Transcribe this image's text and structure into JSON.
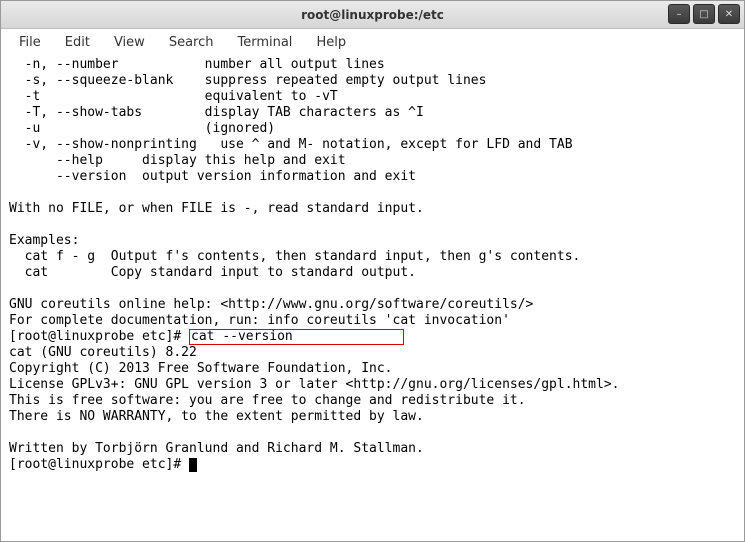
{
  "titlebar": {
    "title": "root@linuxprobe:/etc"
  },
  "window_controls": {
    "minimize": "–",
    "maximize": "□",
    "close": "✕"
  },
  "menubar": {
    "file": "File",
    "edit": "Edit",
    "view": "View",
    "search": "Search",
    "terminal": "Terminal",
    "help": "Help"
  },
  "terminal": {
    "line01": "  -n, --number           number all output lines",
    "line02": "  -s, --squeeze-blank    suppress repeated empty output lines",
    "line03": "  -t                     equivalent to -vT",
    "line04": "  -T, --show-tabs        display TAB characters as ^I",
    "line05": "  -u                     (ignored)",
    "line06": "  -v, --show-nonprinting   use ^ and M- notation, except for LFD and TAB",
    "line07": "      --help     display this help and exit",
    "line08": "      --version  output version information and exit",
    "line09": "",
    "line10": "With no FILE, or when FILE is -, read standard input.",
    "line11": "",
    "line12": "Examples:",
    "line13": "  cat f - g  Output f's contents, then standard input, then g's contents.",
    "line14": "  cat        Copy standard input to standard output.",
    "line15": "",
    "line16": "GNU coreutils online help: <http://www.gnu.org/software/coreutils/>",
    "line17": "For complete documentation, run: info coreutils 'cat invocation'",
    "prompt1_prefix": "[root@linuxprobe etc]# ",
    "prompt1_cmd": "cat --version",
    "line19": "cat (GNU coreutils) 8.22",
    "line20": "Copyright (C) 2013 Free Software Foundation, Inc.",
    "line21": "License GPLv3+: GNU GPL version 3 or later <http://gnu.org/licenses/gpl.html>.",
    "line22": "This is free software: you are free to change and redistribute it.",
    "line23": "There is NO WARRANTY, to the extent permitted by law.",
    "line24": "",
    "line25": "Written by Torbjörn Granlund and Richard M. Stallman.",
    "prompt2": "[root@linuxprobe etc]# "
  }
}
